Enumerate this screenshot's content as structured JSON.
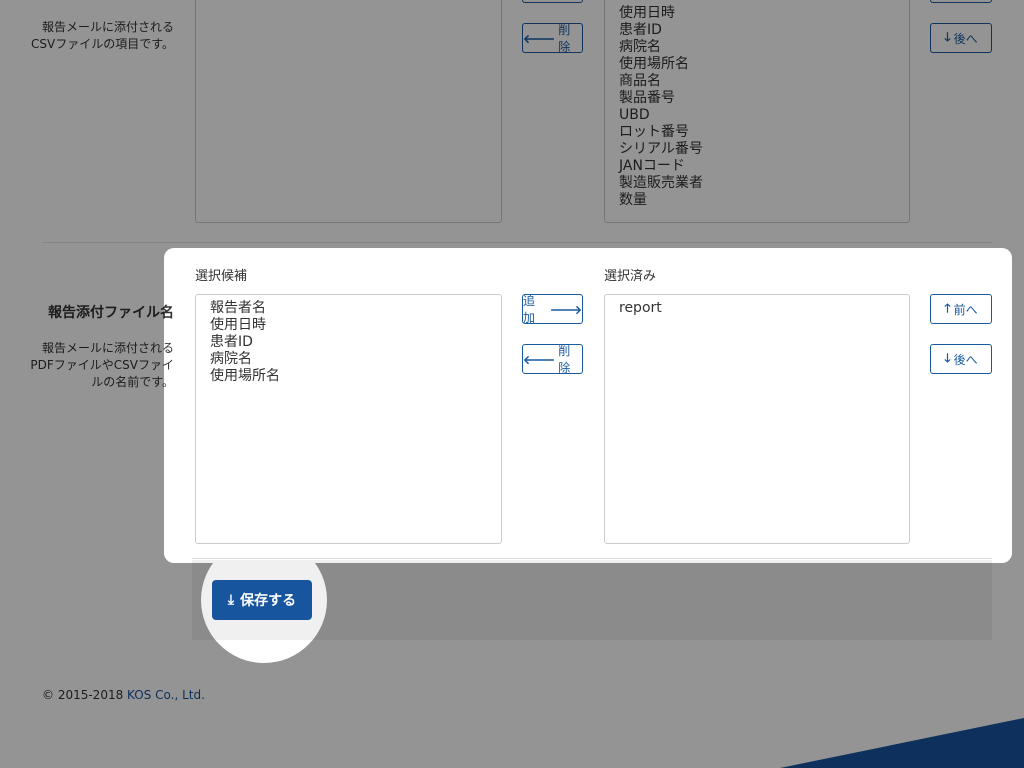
{
  "csv_section": {
    "description": "報告メールに添付される\nCSVファイルの項目です。",
    "selected_items": [
      "使用日時",
      "患者ID",
      "病院名",
      "使用場所名",
      "商品名",
      "製品番号",
      "UBD",
      "ロット番号",
      "シリアル番号",
      "JANコード",
      "製造販売業者",
      "数量"
    ],
    "remove_label": "削除",
    "down_label": "後へ"
  },
  "filename_section": {
    "title": "報告添付ファイル名",
    "description": "報告メールに添付される\nPDFファイルやCSVファイ\nルの名前です。",
    "candidates_label": "選択候補",
    "selected_label": "選択済み",
    "candidates": [
      "報告者名",
      "使用日時",
      "患者ID",
      "病院名",
      "使用場所名"
    ],
    "selected": [
      "report"
    ],
    "add_label": "追加",
    "remove_label": "削除",
    "up_label": "前へ",
    "down_label": "後へ"
  },
  "save": {
    "label": "保存する"
  },
  "footer": {
    "copyright": "© 2015-2018 ",
    "company": "KOS Co., Ltd."
  },
  "colors": {
    "primary": "#17559f",
    "overlay": "rgba(0,0,0,0.42)"
  }
}
